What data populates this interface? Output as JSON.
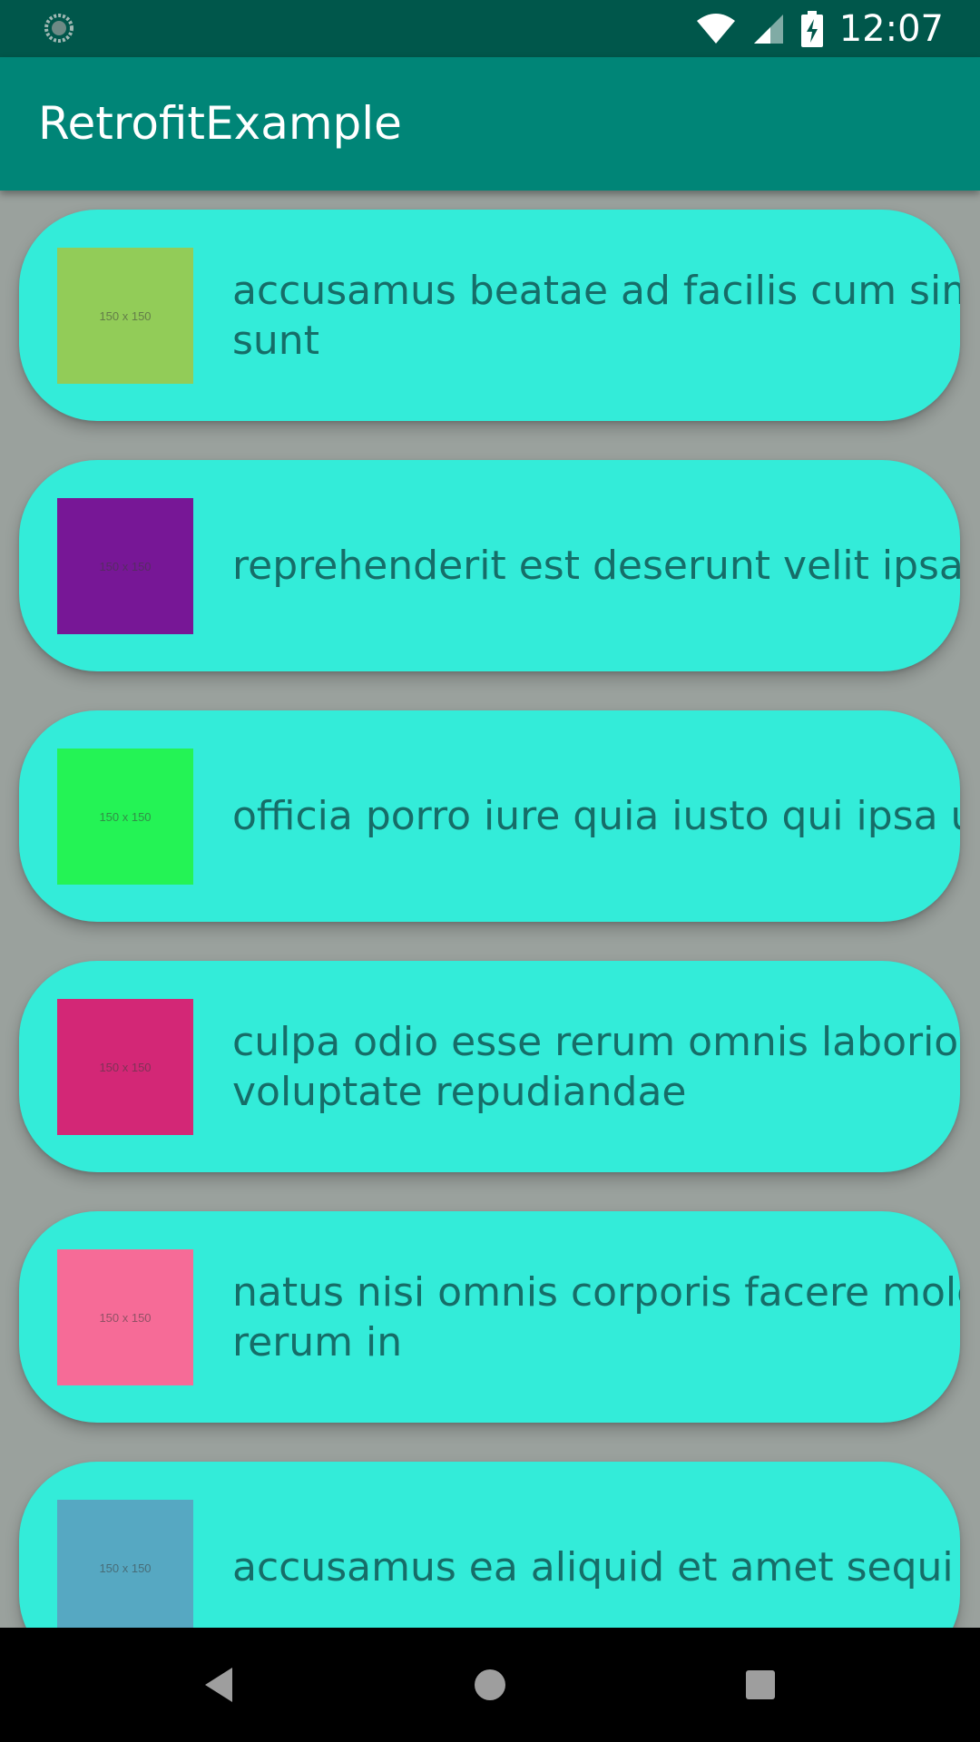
{
  "status_bar": {
    "time": "12:07",
    "icons": [
      "loading-spinner-icon",
      "wifi-icon",
      "signal-icon",
      "battery-charging-icon"
    ]
  },
  "app_bar": {
    "title": "RetrofitExample"
  },
  "colors": {
    "status_bar": "#00574b",
    "app_bar": "#008577",
    "background": "#9aa19d",
    "card": "#33ecd9",
    "card_text": "#166d68"
  },
  "list": {
    "items": [
      {
        "thumbnail_label": "150 x 150",
        "thumbnail_color": "#92cc58",
        "line1": "accusamus beatae ad facilis cum sim",
        "line2": "sunt"
      },
      {
        "thumbnail_label": "150 x 150",
        "thumbnail_color": "#771796",
        "line1": "reprehenderit est deserunt velit ipsam",
        "line2": ""
      },
      {
        "thumbnail_label": "150 x 150",
        "thumbnail_color": "#24f355",
        "line1": "officia porro iure quia iusto qui ipsa ut",
        "line2": ""
      },
      {
        "thumbnail_label": "150 x 150",
        "thumbnail_color": "#d32776",
        "line1": "culpa odio esse rerum omnis laborios",
        "line2": "voluptate repudiandae"
      },
      {
        "thumbnail_label": "150 x 150",
        "thumbnail_color": "#f66b97",
        "line1": "natus nisi omnis corporis facere mole",
        "line2": "rerum in"
      },
      {
        "thumbnail_label": "150 x 150",
        "thumbnail_color": "#56a8c2",
        "line1": "accusamus ea aliquid et amet sequi r",
        "line2": ""
      }
    ]
  },
  "nav_bar": {
    "buttons": [
      "back-icon",
      "home-icon",
      "recents-icon"
    ]
  }
}
